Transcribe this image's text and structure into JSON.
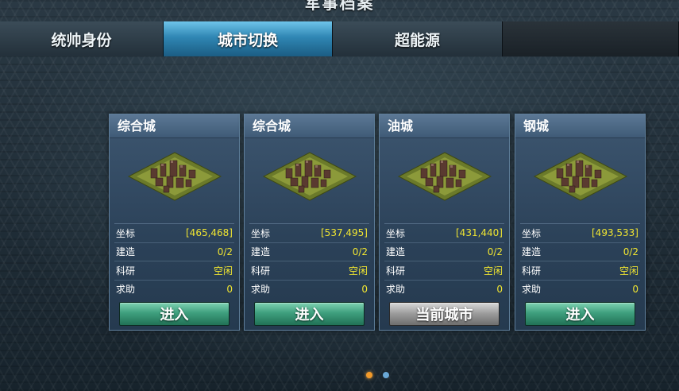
{
  "header": {
    "title": "军事档案"
  },
  "tabs": [
    {
      "label": "统帅身份",
      "active": false
    },
    {
      "label": "城市切换",
      "active": true
    },
    {
      "label": "超能源",
      "active": false
    }
  ],
  "labels": {
    "coord": "坐标",
    "build": "建造",
    "research": "科研",
    "help": "求助"
  },
  "cities": [
    {
      "name": "综合城",
      "coord": "[465,468]",
      "build": "0/2",
      "research": "空闲",
      "help": "0",
      "button": "进入",
      "current": false
    },
    {
      "name": "综合城",
      "coord": "[537,495]",
      "build": "0/2",
      "research": "空闲",
      "help": "0",
      "button": "进入",
      "current": false
    },
    {
      "name": "油城",
      "coord": "[431,440]",
      "build": "0/2",
      "research": "空闲",
      "help": "0",
      "button": "当前城市",
      "current": true
    },
    {
      "name": "钢城",
      "coord": "[493,533]",
      "build": "0/2",
      "research": "空闲",
      "help": "0",
      "button": "进入",
      "current": false
    }
  ],
  "pagination": {
    "current_page": 1,
    "total_pages": 2
  },
  "colors": {
    "active_tab": "#2f86b3",
    "enter_button": "#3fa07e",
    "current_button": "#9a9a9a",
    "value_text": "#f0e531",
    "active_dot": "#f29a2a",
    "inactive_dot": "#6aa8d6"
  },
  "icons": {
    "city": "city-isometric-icon"
  }
}
